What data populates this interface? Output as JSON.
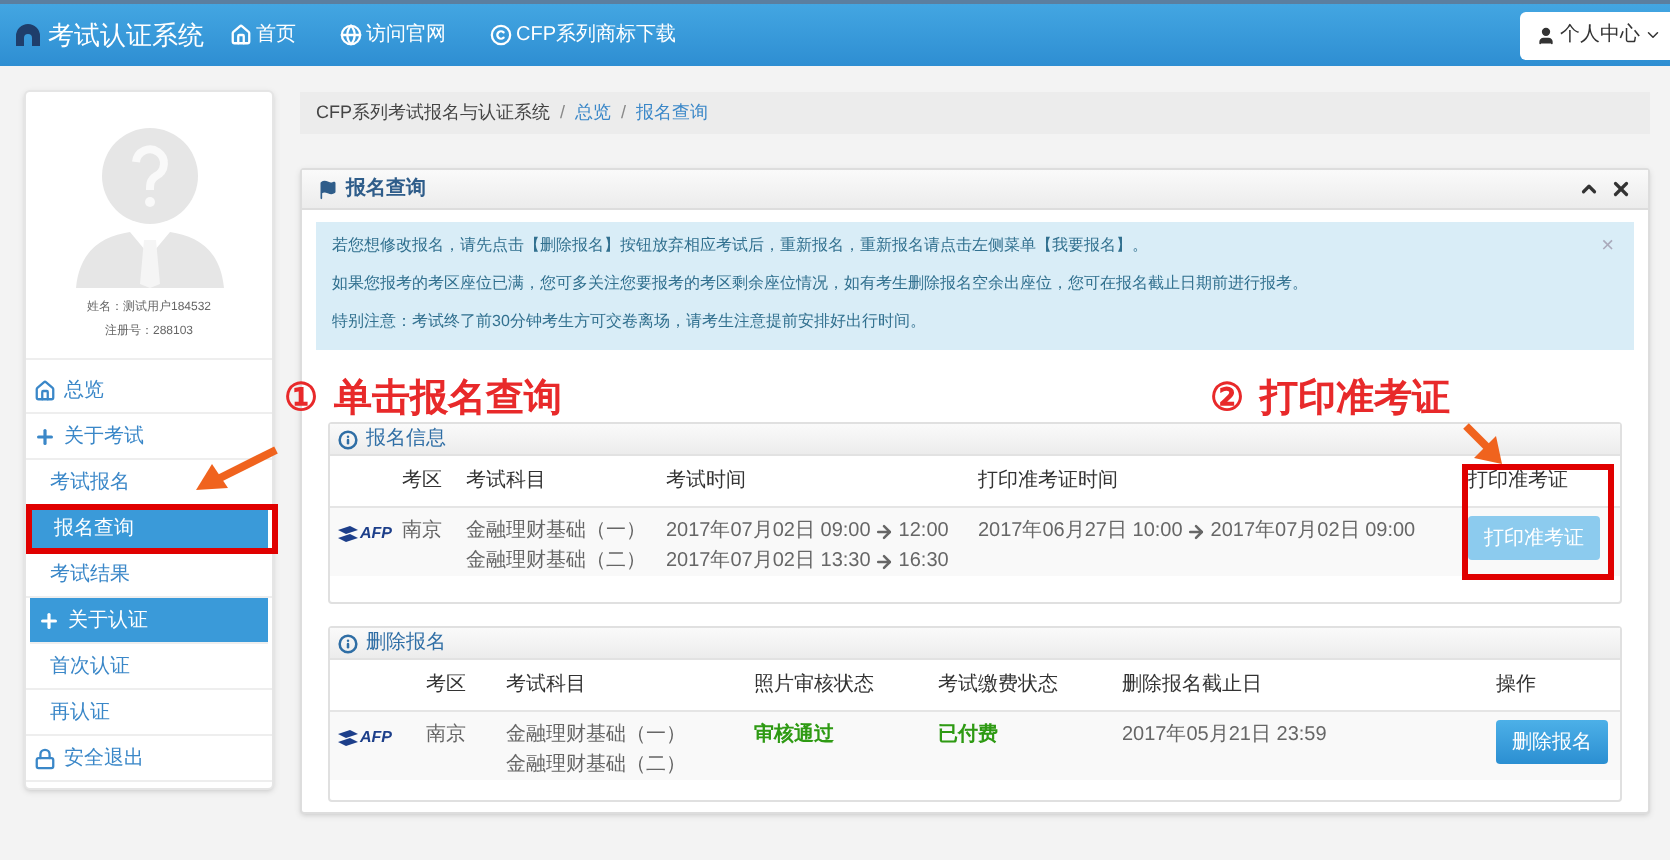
{
  "topbar": {
    "title": "考试认证系统",
    "nav": [
      {
        "kind": "home",
        "label": "首页"
      },
      {
        "kind": "website",
        "label": "访问官网"
      },
      {
        "kind": "download",
        "label": "CFP系列商标下载"
      }
    ],
    "user_menu": "个人中心"
  },
  "profile": {
    "name_line": "姓名：测试用户184532",
    "reg_line": "注册号：288103"
  },
  "sidebar": {
    "items": [
      {
        "kind": "overview",
        "label": "总览",
        "selected": false
      },
      {
        "kind": "group",
        "label": "关于考试",
        "selected": false,
        "children": [
          {
            "kind": "link",
            "label": "考试报名",
            "selected": false
          },
          {
            "kind": "link",
            "label": "报名查询",
            "selected": true
          },
          {
            "kind": "link",
            "label": "考试结果",
            "selected": false
          }
        ]
      },
      {
        "kind": "group",
        "label": "关于认证",
        "selected": true,
        "children": [
          {
            "kind": "link",
            "label": "首次认证",
            "selected": false
          },
          {
            "kind": "link",
            "label": "再认证",
            "selected": false
          }
        ]
      },
      {
        "kind": "logout",
        "label": "安全退出",
        "selected": false
      }
    ]
  },
  "breadcrumb": {
    "separator": "/",
    "items": [
      {
        "label": "CFP系列考试报名与认证系统",
        "link": false
      },
      {
        "label": "总览",
        "link": true
      },
      {
        "label": "报名查询",
        "link": true
      }
    ]
  },
  "panel": {
    "title": "报名查询",
    "alert": {
      "close": "×",
      "lines": [
        "若您想修改报名，请先点击【删除报名】按钮放弃相应考试后，重新报名，重新报名请点击左侧菜单【我要报名】。",
        "如果您报考的考区座位已满，您可多关注您要报考的考区剩余座位情况，如有考生删除报名空余出座位，您可在报名截止日期前进行报考。",
        "特别注意：考试终了前30分钟考生方可交卷离场，请考生注意提前安排好出行时间。"
      ]
    },
    "registration": {
      "title": "报名信息",
      "columns": [
        "考区",
        "考试科目",
        "考试时间",
        "打印准考证时间",
        "打印准考证"
      ],
      "rows": [
        {
          "logo": "AFP",
          "region": "南京",
          "subjects": [
            "金融理财基础（一）",
            "金融理财基础（二）"
          ],
          "exam_times": [
            {
              "start": "2017年07月02日 09:00",
              "end": "12:00"
            },
            {
              "start": "2017年07月02日 13:30",
              "end": "16:30"
            }
          ],
          "print_time": {
            "start": "2017年06月27日 10:00",
            "end": "2017年07月02日 09:00"
          },
          "button": "打印准考证",
          "disabled": true
        }
      ]
    },
    "deletion": {
      "title": "删除报名",
      "columns": [
        "考区",
        "考试科目",
        "照片审核状态",
        "考试缴费状态",
        "删除报名截止日",
        "操作"
      ],
      "rows": [
        {
          "logo": "AFP",
          "region": "南京",
          "subjects": [
            "金融理财基础（一）",
            "金融理财基础（二）"
          ],
          "photo_status": "审核通过",
          "payment_status": "已付费",
          "deadline": "2017年05月21日 23:59",
          "button": "删除报名",
          "disabled": false
        }
      ]
    }
  },
  "annotations": [
    {
      "number": "①",
      "text": "单击报名查询"
    },
    {
      "number": "②",
      "text": "打印准考证"
    }
  ]
}
